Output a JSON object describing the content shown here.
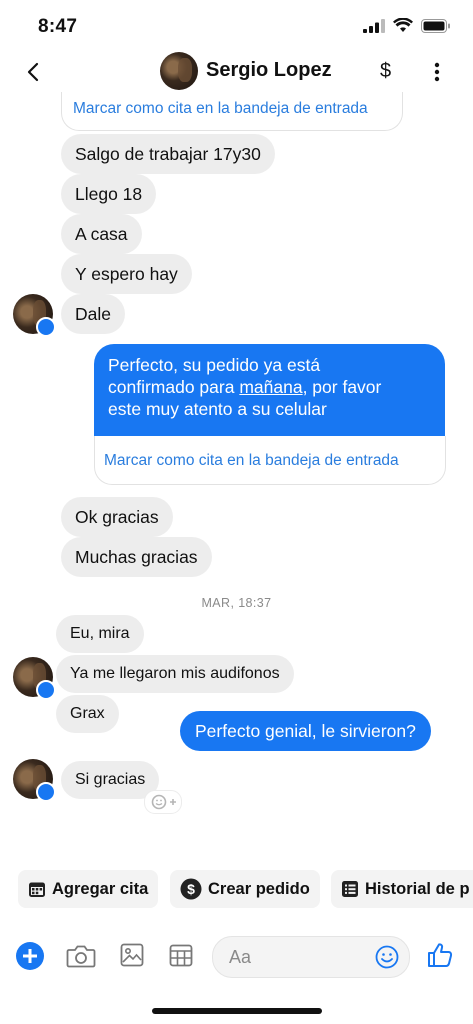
{
  "status": {
    "time": "8:47"
  },
  "header": {
    "name": "Sergio Lopez",
    "dollar": "$"
  },
  "messages": {
    "top_link": "Marcar como cita en la bandeja de entrada",
    "in1": "Salgo de trabajar 17y30",
    "in2": "Llego 18",
    "in3": "A casa",
    "in4": "Y espero hay",
    "in5": "Dale",
    "out1_part1": "Perfecto, su pedido ya está",
    "out1_part2": "confirmado para ",
    "out1_underlined": "mañana",
    "out1_part3": ", por favor",
    "out1_part4": "este muy atento a su celular",
    "out1_link": "Marcar como cita en la bandeja de entrada",
    "in6": "Ok gracias",
    "in7": "Muchas gracias",
    "timestamp": "MAR, 18:37",
    "in8": "Eu, mira",
    "in9": "Ya me llegaron mis audifonos",
    "in10": "Grax",
    "out2": "Perfecto genial, le sirvieron?",
    "in11": "Si gracias"
  },
  "actions": {
    "agregar": "Agregar cita",
    "crear": "Crear pedido",
    "historial": "Historial de p"
  },
  "composer": {
    "placeholder": "Aa"
  },
  "colors": {
    "accent": "#1877f2",
    "bubble_in": "#ededed",
    "link": "#2a7dde"
  }
}
